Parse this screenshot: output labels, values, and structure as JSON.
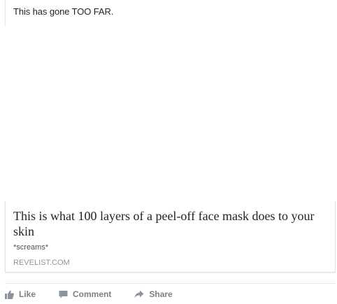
{
  "post": {
    "message": "This has gone TOO FAR."
  },
  "link_card": {
    "title": "This is what 100 layers of a peel-off face mask does to your skin",
    "description": "*screams*",
    "domain": "REVELIST.COM"
  },
  "actions": {
    "like_label": "Like",
    "comment_label": "Comment",
    "share_label": "Share",
    "like_icon": "thumbs-up-icon",
    "comment_icon": "speech-bubble-icon",
    "share_icon": "share-arrow-icon"
  },
  "colors": {
    "text": "#1d2129",
    "muted": "#90949c",
    "action": "#7f7f7f",
    "border": "#dddfe2"
  }
}
